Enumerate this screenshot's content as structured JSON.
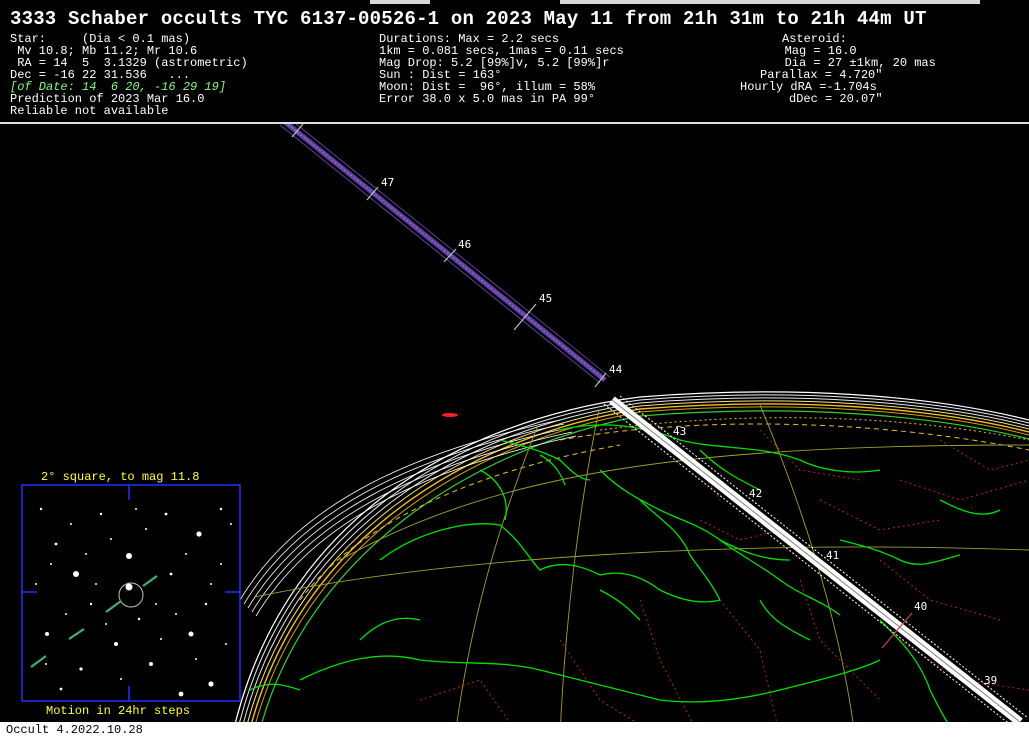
{
  "title": "3333 Schaber occults TYC 6137-00526-1 on 2023 May 11 from 21h 31m to 21h 44m UT",
  "star": {
    "lines": [
      "Star:     (Dia < 0.1 mas)",
      " Mv 10.8; Mb 11.2; Mr 10.6",
      " RA = 14  5  3.1329 (astrometric)",
      "Dec = -16 22 31.536   ...",
      "[of Date: 14  6 20, -16 29 19]",
      "Prediction of 2023 Mar 16.0",
      "Reliable not available"
    ]
  },
  "event": {
    "lines": [
      "Durations: Max = 2.2 secs",
      "1km = 0.081 secs, 1mas = 0.11 secs",
      "Mag Drop: 5.2 [99%]v, 5.2 [99%]r",
      "Sun : Dist = 163°",
      "Moon: Dist =  96°, illum = 58%",
      "Error 38.0 x 5.0 mas in PA 99°"
    ]
  },
  "asteroid": {
    "lines": [
      "Asteroid:",
      "   Mag = 16.0",
      "   Dia = 27 ±1km, 20 mas",
      "Parallax = 4.720\"",
      "Hourly dRA =-1.704s",
      "dDec = 20.07\""
    ]
  },
  "path_minutes": {
    "labels": [
      "47",
      "46",
      "45",
      "44",
      "43",
      "42",
      "41",
      "40",
      "39"
    ]
  },
  "inset": {
    "title": "2° square, to mag 11.8",
    "motion_label": "Motion in 24hr steps"
  },
  "footer": "Occult 4.2022.10.28",
  "colors": {
    "background": "#000000",
    "coast": "#00e000",
    "borders": "#c02020",
    "grid": "#a0a030",
    "path": "#ffffff",
    "horizon": "#e0c020",
    "inset_frame": "#2030ff",
    "track": "#8050c0"
  }
}
